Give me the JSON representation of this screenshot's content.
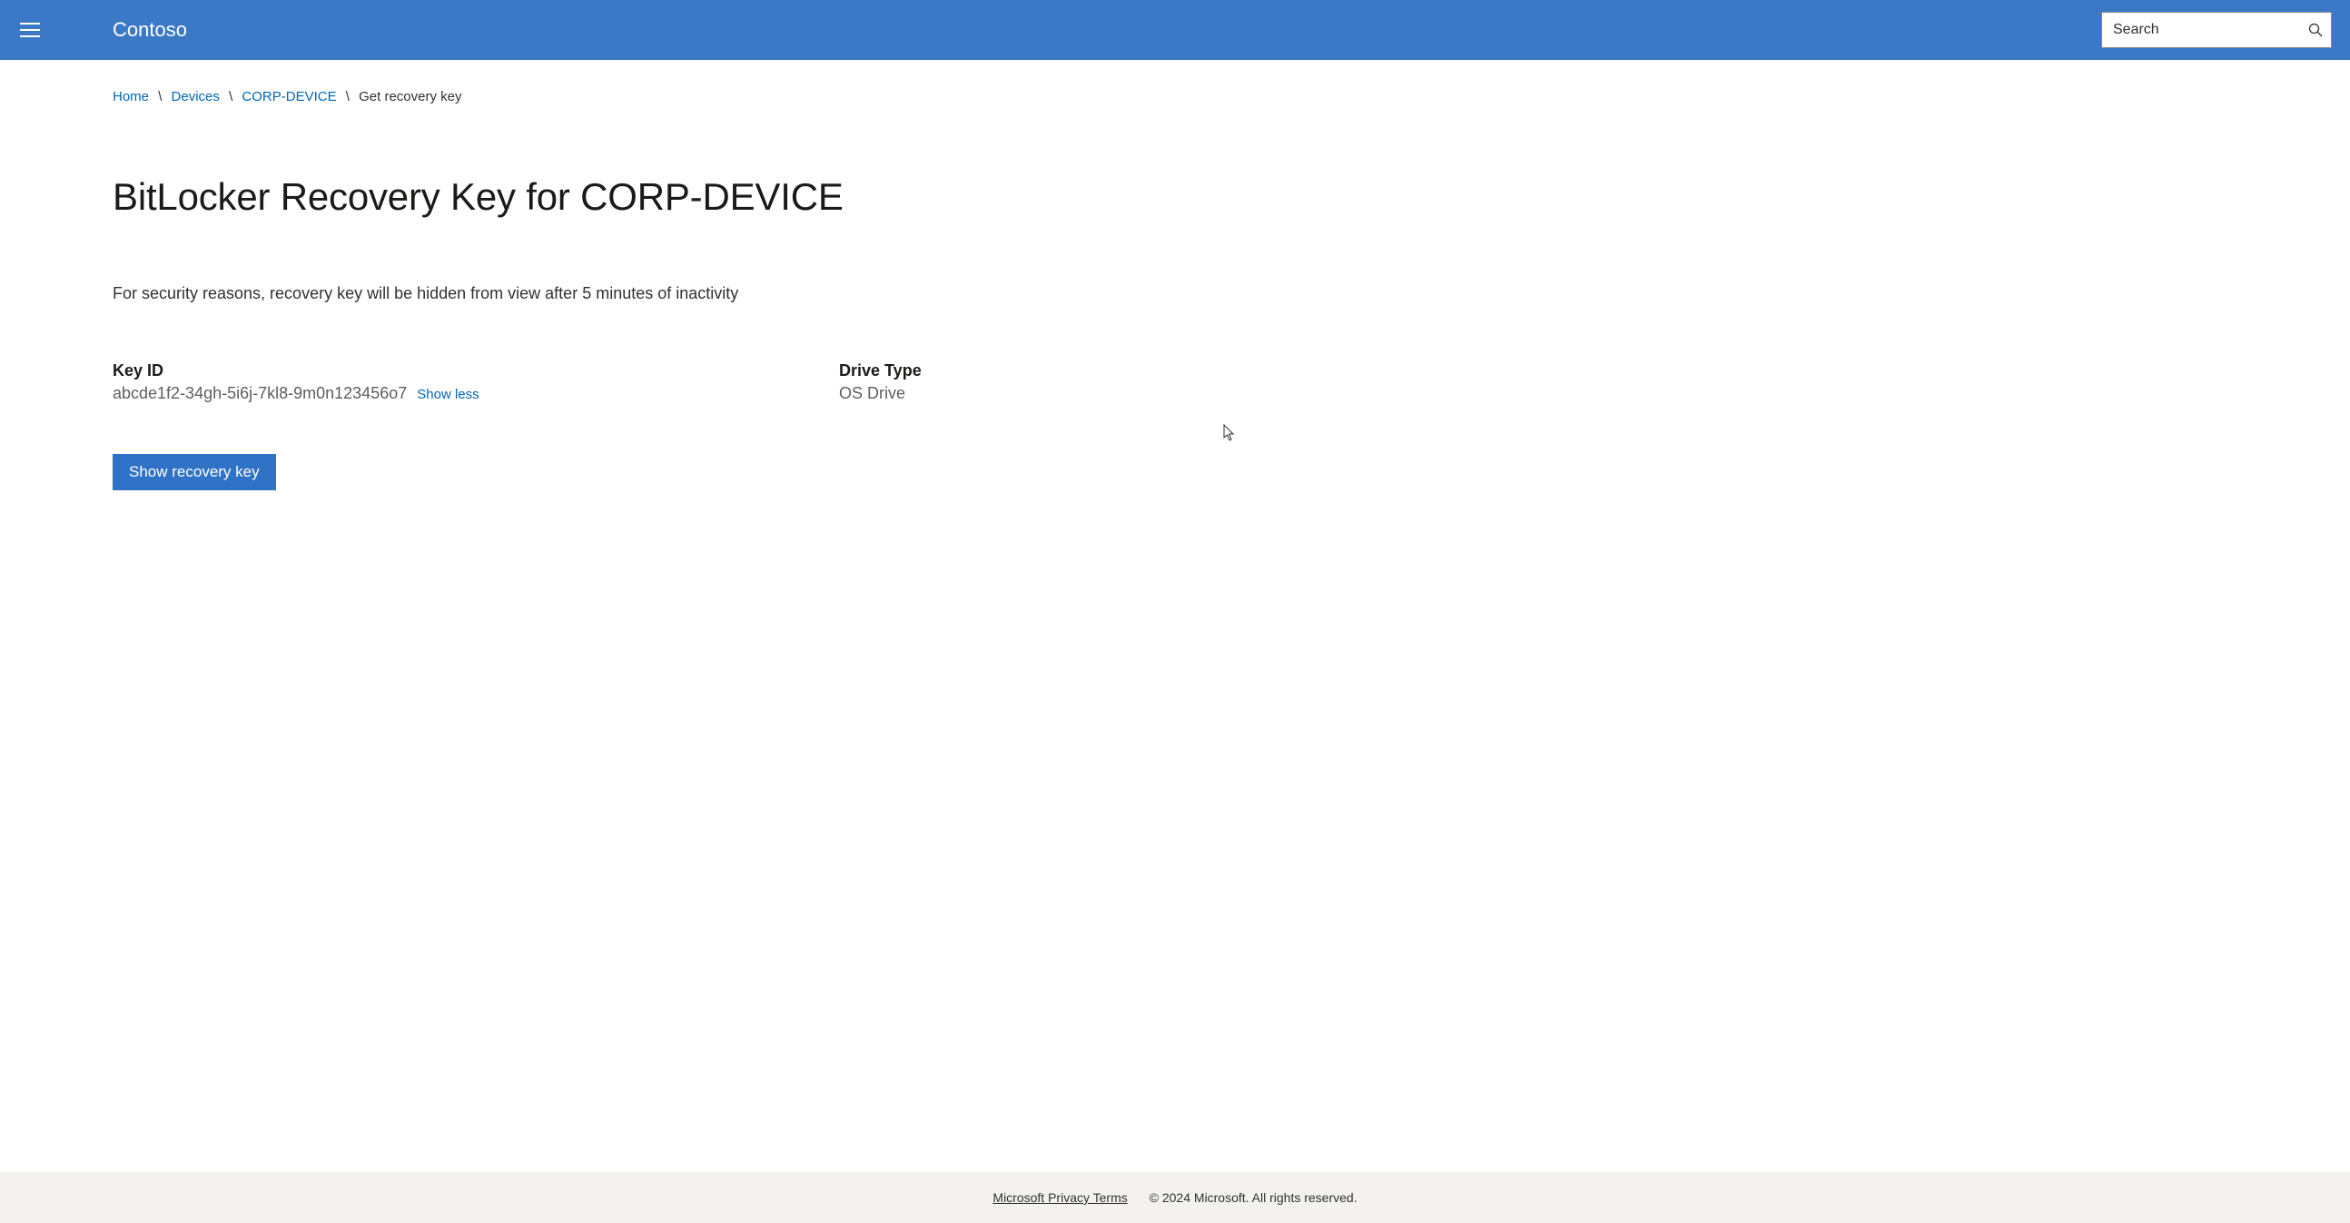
{
  "header": {
    "brand": "Contoso",
    "search_placeholder": "Search"
  },
  "breadcrumb": {
    "items": [
      {
        "label": "Home",
        "link": true
      },
      {
        "label": "Devices",
        "link": true
      },
      {
        "label": "CORP-DEVICE",
        "link": true
      },
      {
        "label": "Get recovery key",
        "link": false
      }
    ]
  },
  "page": {
    "title": "BitLocker Recovery Key for CORP-DEVICE",
    "note": "For security reasons, recovery key will be hidden from view after 5 minutes of inactivity"
  },
  "key": {
    "id_label": "Key ID",
    "id_value": "abcde1f2-34gh-5i6j-7kl8-9m0n123456o7",
    "show_less": "Show less",
    "drive_label": "Drive Type",
    "drive_value": "OS Drive",
    "show_button": "Show recovery key"
  },
  "footer": {
    "privacy": "Microsoft Privacy Terms",
    "copyright": "© 2024 Microsoft. All rights reserved."
  }
}
